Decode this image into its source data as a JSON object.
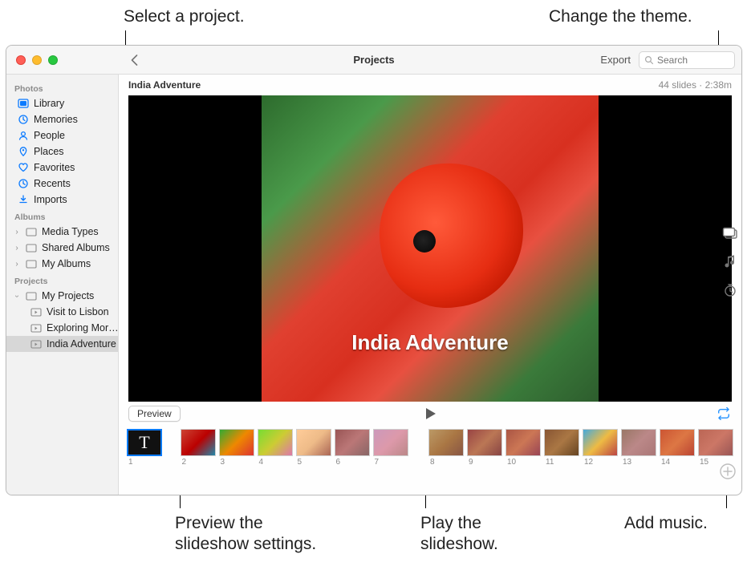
{
  "callouts": {
    "select_project": "Select a project.",
    "change_theme": "Change the theme.",
    "preview_settings_l1": "Preview the",
    "preview_settings_l2": "slideshow settings.",
    "play_slideshow_l1": "Play the",
    "play_slideshow_l2": "slideshow.",
    "add_music": "Add music."
  },
  "titlebar": {
    "title": "Projects",
    "export": "Export",
    "search_placeholder": "Search"
  },
  "sidebar": {
    "groups": {
      "photos": "Photos",
      "albums": "Albums",
      "projects": "Projects"
    },
    "photos_items": {
      "library": "Library",
      "memories": "Memories",
      "people": "People",
      "places": "Places",
      "favorites": "Favorites",
      "recents": "Recents",
      "imports": "Imports"
    },
    "albums_items": {
      "media_types": "Media Types",
      "shared_albums": "Shared Albums",
      "my_albums": "My Albums"
    },
    "projects_items": {
      "my_projects": "My Projects",
      "children": {
        "visit_lisbon": "Visit to Lisbon",
        "exploring": "Exploring Mor…",
        "india": "India Adventure"
      }
    }
  },
  "project": {
    "name": "India Adventure",
    "status": "44 slides · 2:38m",
    "overlay_title": "India Adventure"
  },
  "controls": {
    "preview": "Preview"
  },
  "filmstrip": {
    "title_glyph": "T",
    "numbers": [
      "1",
      "2",
      "3",
      "4",
      "5",
      "6",
      "7",
      "8",
      "9",
      "10",
      "11",
      "12",
      "13",
      "14",
      "15"
    ]
  }
}
